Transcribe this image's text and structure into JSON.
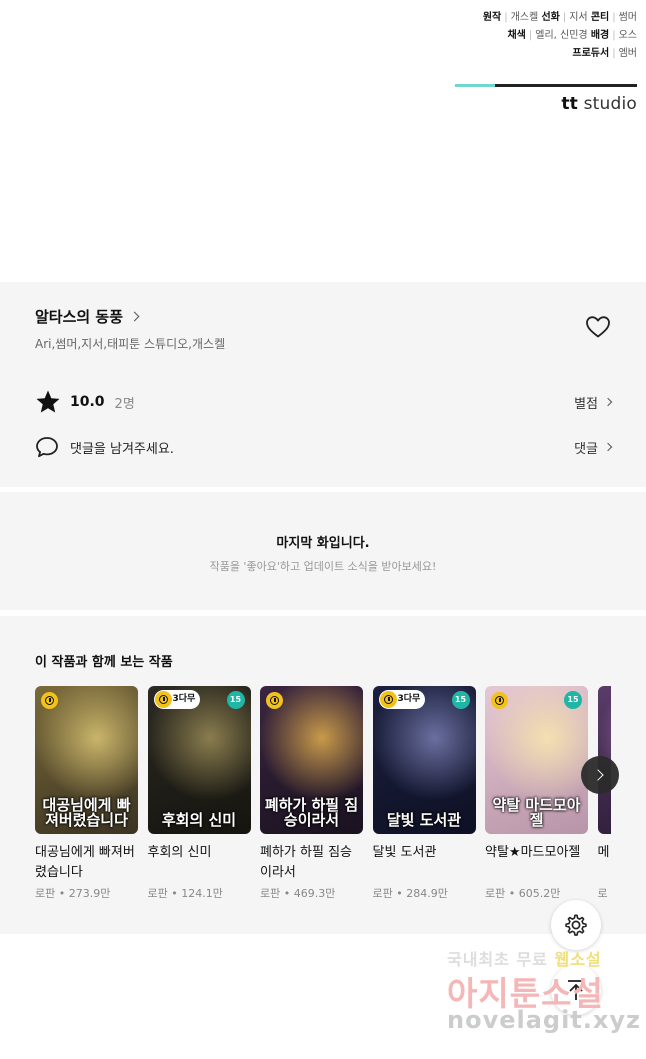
{
  "credits": {
    "rows": [
      {
        "key": "원작",
        "value": "개스켈",
        "key2": "선화",
        "value2": "지서",
        "key3": "콘티",
        "value3": "썸머"
      },
      {
        "key": "채색",
        "value": "엘리, 신민경",
        "key2": "배경",
        "value2": "오스"
      },
      {
        "key": "프로듀서",
        "value": "엠버"
      }
    ],
    "studio_prefix": "tt",
    "studio_name": "studio",
    "accent_color": "#6fd6d0"
  },
  "work": {
    "title": "알타스의 동풍",
    "authors": "Ari,썸머,지서,태피툰 스튜디오,개스켈",
    "rating": "10.0",
    "rating_count": "2명",
    "rate_link": "별점",
    "comment_placeholder": "댓글을 남겨주세요.",
    "comment_link": "댓글",
    "icons": {
      "like": "heart-icon",
      "rating": "star-icon",
      "comment": "speech-bubble-icon"
    }
  },
  "notice": {
    "title": "마지막 화입니다.",
    "subtitle": "작품을 '좋아요'하고 업데이트 소식을 받아보세요!"
  },
  "recommendations": {
    "heading": "이 작품과 함께 보는 작품",
    "items": [
      {
        "title": "대공님에게 빠져버렸습니다",
        "cover_title": "대공님에게 빠져버렸습니다",
        "meta": "로판 • 273.9만",
        "badge": "clock",
        "age": "",
        "colors": [
          "#7a6a3a",
          "#c9b56a",
          "#3b3322"
        ]
      },
      {
        "title": "후회의 신미",
        "cover_title": "후회의 신미",
        "meta": "로판 • 124.1만",
        "badge": "3다무",
        "age": "15",
        "colors": [
          "#2c2a22",
          "#8a7d4e",
          "#15140f"
        ]
      },
      {
        "title": "폐하가 하필 짐승이라서",
        "cover_title": "폐하가 하필 짐승이라서",
        "meta": "로판 • 469.3만",
        "badge": "clock",
        "age": "",
        "colors": [
          "#3a2540",
          "#c89a4a",
          "#1a1220"
        ]
      },
      {
        "title": "달빛 도서관",
        "cover_title": "달빛 도서관",
        "meta": "로판 • 284.9만",
        "badge": "3다무",
        "age": "15",
        "colors": [
          "#1c2140",
          "#6a6fa0",
          "#0e1024"
        ]
      },
      {
        "title": "약탈★마드모아젤",
        "cover_title": "약탈 마드모아젤",
        "meta": "로판 • 605.2만",
        "badge": "clock",
        "age": "15",
        "colors": [
          "#e6c8d4",
          "#f3e0b0",
          "#b894a8"
        ]
      },
      {
        "title": "메",
        "cover_title": "",
        "meta": "로",
        "badge": "",
        "age": "",
        "colors": [
          "#5a3c6a",
          "#a07ab0",
          "#2a1a34"
        ]
      }
    ]
  },
  "watermark": {
    "line1_a": "국내최초 무료",
    "line1_b": "웹소설",
    "line2": "아지툰소설",
    "line3": "novelagit.xyz"
  }
}
